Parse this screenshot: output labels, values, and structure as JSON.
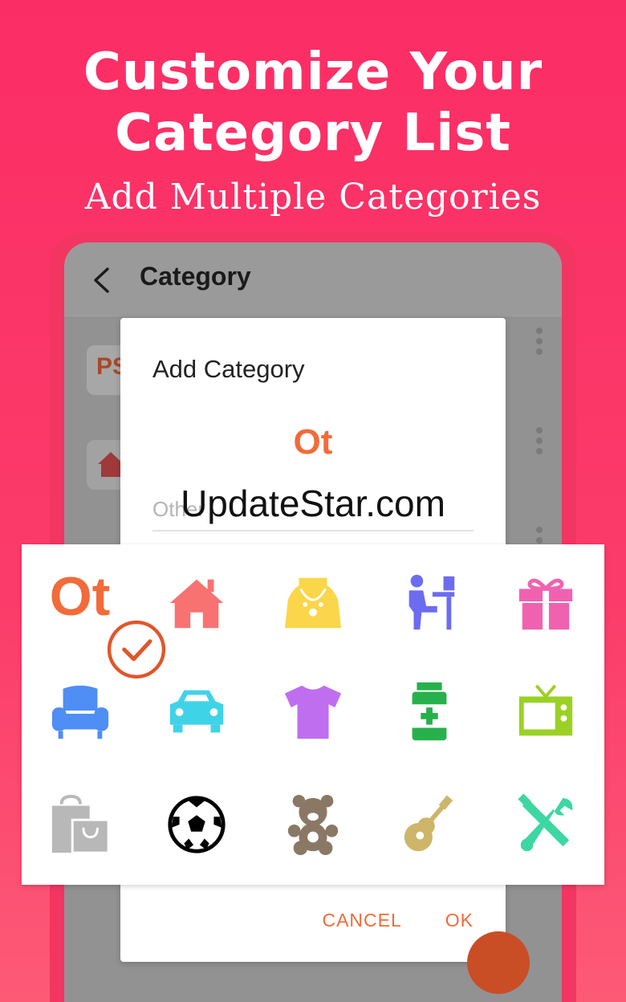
{
  "hero": {
    "title_line1": "Customize Your",
    "title_line2": "Category List",
    "subtitle": "Add Multiple Categories"
  },
  "appbar": {
    "title": "Category"
  },
  "list": {
    "chip_text": "PS"
  },
  "dialog": {
    "title": "Add Category",
    "preview_text": "Ot",
    "input_value": "Other",
    "cancel_label": "CANCEL",
    "ok_label": "OK"
  },
  "watermark": "UpdateStar.com",
  "icon_grid": {
    "selected_text": "Ot",
    "icons": [
      "text-ot",
      "home-icon",
      "necklace-icon",
      "desk-worker-icon",
      "gift-icon",
      "armchair-icon",
      "car-icon",
      "tshirt-icon",
      "medicine-icon",
      "tv-icon",
      "shopping-bag-icon",
      "soccer-ball-icon",
      "teddy-bear-icon",
      "guitar-icon",
      "tools-icon"
    ]
  },
  "colors": {
    "background": "#fb2d65",
    "accent": "#f26b3a",
    "home": "#f87272",
    "necklace": "#fbd64a",
    "desk": "#6c6cf0",
    "gift": "#f062b0",
    "armchair": "#4e8ef5",
    "car": "#3fd3e8",
    "tshirt": "#c06ef0",
    "medicine": "#27b14c",
    "tv": "#9bd124",
    "bag": "#b8b8b8",
    "teddy": "#8a7865",
    "guitar": "#cdb56a",
    "tools": "#3dd7a2"
  }
}
